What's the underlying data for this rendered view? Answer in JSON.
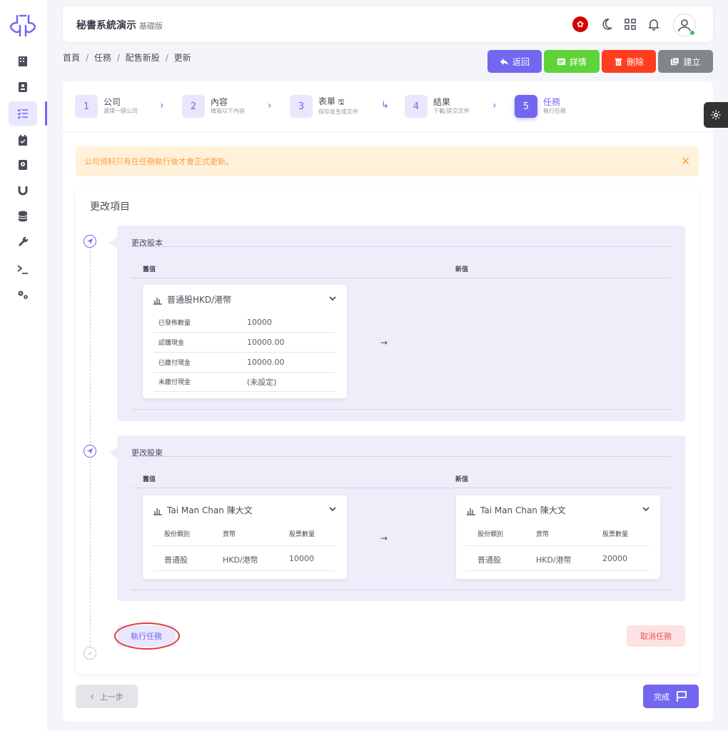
{
  "app": {
    "title": "秘書系統演示",
    "subtitle": "基礎版"
  },
  "breadcrumb": [
    "首頁",
    "任務",
    "配售新股",
    "更新"
  ],
  "actions": {
    "back": "返回",
    "details": "詳情",
    "delete": "刪除",
    "create": "建立"
  },
  "colors": {
    "primary": "#7367f0",
    "success": "#5fd33a",
    "danger": "#ff3d1f",
    "secondary": "#82868b",
    "warning": "#ff9f43"
  },
  "stepper": [
    {
      "num": "1",
      "title": "公司",
      "desc": "選擇一個公司"
    },
    {
      "num": "2",
      "title": "內容",
      "desc": "填寫以下內容"
    },
    {
      "num": "3",
      "title": "表單",
      "desc": "保存並生成文件"
    },
    {
      "num": "4",
      "title": "結果",
      "desc": "下載/提交文件"
    },
    {
      "num": "5",
      "title": "任務",
      "desc": "執行任務"
    }
  ],
  "alert": {
    "text": "公司資料只有在任務執行後才會正式更新。",
    "close": "✕"
  },
  "changes": {
    "title": "更改項目",
    "capital": {
      "title": "更改股本",
      "old_label": "舊值",
      "new_label": "新值",
      "card_title": "普通股HKD/港幣",
      "rows": [
        {
          "k": "已發佈數量",
          "v": "10000"
        },
        {
          "k": "認購現金",
          "v": "10000.00"
        },
        {
          "k": "已繳付現金",
          "v": "10000.00"
        },
        {
          "k": "未繳付現金",
          "v": "(未設定)"
        }
      ],
      "arrow": "→"
    },
    "shareholder": {
      "title": "更改股東",
      "old_label": "舊值",
      "new_label": "新值",
      "arrow": "→",
      "old": {
        "name": "Tai Man Chan 陳大文",
        "headers": [
          "股份類別",
          "貨幣",
          "股票數量"
        ],
        "row": [
          "普通股",
          "HKD/港幣",
          "10000"
        ]
      },
      "new": {
        "name": "Tai Man Chan 陳大文",
        "headers": [
          "股份類別",
          "貨幣",
          "股票數量"
        ],
        "row": [
          "普通股",
          "HKD/港幣",
          "20000"
        ]
      }
    },
    "execute": "執行任務",
    "cancel": "取消任務"
  },
  "footer": {
    "prev": "上一步",
    "finish": "完成"
  }
}
